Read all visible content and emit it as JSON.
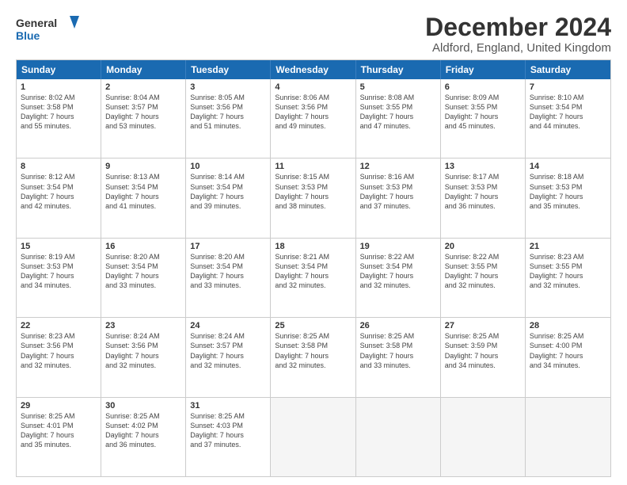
{
  "logo": {
    "line1": "General",
    "line2": "Blue"
  },
  "title": "December 2024",
  "location": "Aldford, England, United Kingdom",
  "days_header": [
    "Sunday",
    "Monday",
    "Tuesday",
    "Wednesday",
    "Thursday",
    "Friday",
    "Saturday"
  ],
  "weeks": [
    [
      {
        "day": "1",
        "lines": [
          "Sunrise: 8:02 AM",
          "Sunset: 3:58 PM",
          "Daylight: 7 hours",
          "and 55 minutes."
        ]
      },
      {
        "day": "2",
        "lines": [
          "Sunrise: 8:04 AM",
          "Sunset: 3:57 PM",
          "Daylight: 7 hours",
          "and 53 minutes."
        ]
      },
      {
        "day": "3",
        "lines": [
          "Sunrise: 8:05 AM",
          "Sunset: 3:56 PM",
          "Daylight: 7 hours",
          "and 51 minutes."
        ]
      },
      {
        "day": "4",
        "lines": [
          "Sunrise: 8:06 AM",
          "Sunset: 3:56 PM",
          "Daylight: 7 hours",
          "and 49 minutes."
        ]
      },
      {
        "day": "5",
        "lines": [
          "Sunrise: 8:08 AM",
          "Sunset: 3:55 PM",
          "Daylight: 7 hours",
          "and 47 minutes."
        ]
      },
      {
        "day": "6",
        "lines": [
          "Sunrise: 8:09 AM",
          "Sunset: 3:55 PM",
          "Daylight: 7 hours",
          "and 45 minutes."
        ]
      },
      {
        "day": "7",
        "lines": [
          "Sunrise: 8:10 AM",
          "Sunset: 3:54 PM",
          "Daylight: 7 hours",
          "and 44 minutes."
        ]
      }
    ],
    [
      {
        "day": "8",
        "lines": [
          "Sunrise: 8:12 AM",
          "Sunset: 3:54 PM",
          "Daylight: 7 hours",
          "and 42 minutes."
        ]
      },
      {
        "day": "9",
        "lines": [
          "Sunrise: 8:13 AM",
          "Sunset: 3:54 PM",
          "Daylight: 7 hours",
          "and 41 minutes."
        ]
      },
      {
        "day": "10",
        "lines": [
          "Sunrise: 8:14 AM",
          "Sunset: 3:54 PM",
          "Daylight: 7 hours",
          "and 39 minutes."
        ]
      },
      {
        "day": "11",
        "lines": [
          "Sunrise: 8:15 AM",
          "Sunset: 3:53 PM",
          "Daylight: 7 hours",
          "and 38 minutes."
        ]
      },
      {
        "day": "12",
        "lines": [
          "Sunrise: 8:16 AM",
          "Sunset: 3:53 PM",
          "Daylight: 7 hours",
          "and 37 minutes."
        ]
      },
      {
        "day": "13",
        "lines": [
          "Sunrise: 8:17 AM",
          "Sunset: 3:53 PM",
          "Daylight: 7 hours",
          "and 36 minutes."
        ]
      },
      {
        "day": "14",
        "lines": [
          "Sunrise: 8:18 AM",
          "Sunset: 3:53 PM",
          "Daylight: 7 hours",
          "and 35 minutes."
        ]
      }
    ],
    [
      {
        "day": "15",
        "lines": [
          "Sunrise: 8:19 AM",
          "Sunset: 3:53 PM",
          "Daylight: 7 hours",
          "and 34 minutes."
        ]
      },
      {
        "day": "16",
        "lines": [
          "Sunrise: 8:20 AM",
          "Sunset: 3:54 PM",
          "Daylight: 7 hours",
          "and 33 minutes."
        ]
      },
      {
        "day": "17",
        "lines": [
          "Sunrise: 8:20 AM",
          "Sunset: 3:54 PM",
          "Daylight: 7 hours",
          "and 33 minutes."
        ]
      },
      {
        "day": "18",
        "lines": [
          "Sunrise: 8:21 AM",
          "Sunset: 3:54 PM",
          "Daylight: 7 hours",
          "and 32 minutes."
        ]
      },
      {
        "day": "19",
        "lines": [
          "Sunrise: 8:22 AM",
          "Sunset: 3:54 PM",
          "Daylight: 7 hours",
          "and 32 minutes."
        ]
      },
      {
        "day": "20",
        "lines": [
          "Sunrise: 8:22 AM",
          "Sunset: 3:55 PM",
          "Daylight: 7 hours",
          "and 32 minutes."
        ]
      },
      {
        "day": "21",
        "lines": [
          "Sunrise: 8:23 AM",
          "Sunset: 3:55 PM",
          "Daylight: 7 hours",
          "and 32 minutes."
        ]
      }
    ],
    [
      {
        "day": "22",
        "lines": [
          "Sunrise: 8:23 AM",
          "Sunset: 3:56 PM",
          "Daylight: 7 hours",
          "and 32 minutes."
        ]
      },
      {
        "day": "23",
        "lines": [
          "Sunrise: 8:24 AM",
          "Sunset: 3:56 PM",
          "Daylight: 7 hours",
          "and 32 minutes."
        ]
      },
      {
        "day": "24",
        "lines": [
          "Sunrise: 8:24 AM",
          "Sunset: 3:57 PM",
          "Daylight: 7 hours",
          "and 32 minutes."
        ]
      },
      {
        "day": "25",
        "lines": [
          "Sunrise: 8:25 AM",
          "Sunset: 3:58 PM",
          "Daylight: 7 hours",
          "and 32 minutes."
        ]
      },
      {
        "day": "26",
        "lines": [
          "Sunrise: 8:25 AM",
          "Sunset: 3:58 PM",
          "Daylight: 7 hours",
          "and 33 minutes."
        ]
      },
      {
        "day": "27",
        "lines": [
          "Sunrise: 8:25 AM",
          "Sunset: 3:59 PM",
          "Daylight: 7 hours",
          "and 34 minutes."
        ]
      },
      {
        "day": "28",
        "lines": [
          "Sunrise: 8:25 AM",
          "Sunset: 4:00 PM",
          "Daylight: 7 hours",
          "and 34 minutes."
        ]
      }
    ],
    [
      {
        "day": "29",
        "lines": [
          "Sunrise: 8:25 AM",
          "Sunset: 4:01 PM",
          "Daylight: 7 hours",
          "and 35 minutes."
        ]
      },
      {
        "day": "30",
        "lines": [
          "Sunrise: 8:25 AM",
          "Sunset: 4:02 PM",
          "Daylight: 7 hours",
          "and 36 minutes."
        ]
      },
      {
        "day": "31",
        "lines": [
          "Sunrise: 8:25 AM",
          "Sunset: 4:03 PM",
          "Daylight: 7 hours",
          "and 37 minutes."
        ]
      },
      {
        "day": "",
        "lines": []
      },
      {
        "day": "",
        "lines": []
      },
      {
        "day": "",
        "lines": []
      },
      {
        "day": "",
        "lines": []
      }
    ]
  ]
}
